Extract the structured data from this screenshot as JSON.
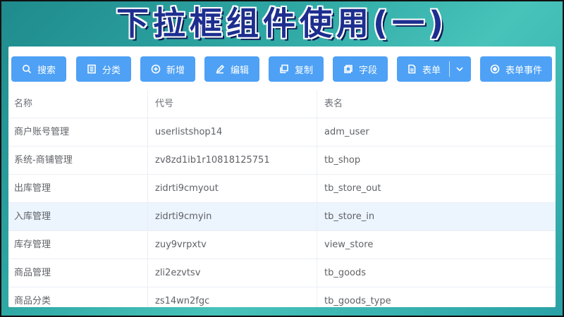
{
  "title": "下拉框组件使用(一)",
  "toolbar": {
    "search": {
      "label": "搜索",
      "icon": "search-icon"
    },
    "category": {
      "label": "分类",
      "icon": "list-icon"
    },
    "add": {
      "label": "新增",
      "icon": "plus-circle-icon"
    },
    "edit": {
      "label": "编辑",
      "icon": "pencil-icon"
    },
    "copy": {
      "label": "复制",
      "icon": "copy-icon"
    },
    "fields": {
      "label": "字段",
      "icon": "fields-icon"
    },
    "form": {
      "label": "表单",
      "icon": "document-icon"
    },
    "form_events": {
      "label": "表单事件",
      "icon": "target-icon"
    }
  },
  "colors": {
    "button": "#4ea1f5",
    "highlight_row": "#ecf4fd",
    "title": "#1d2e8f"
  },
  "table": {
    "columns": [
      "名称",
      "代号",
      "表名"
    ],
    "rows": [
      [
        "商户账号管理",
        "userlistshop14",
        "adm_user"
      ],
      [
        "系统-商铺管理",
        "zv8zd1ib1r10818125751",
        "tb_shop"
      ],
      [
        "出库管理",
        "zidrti9cmyout",
        "tb_store_out"
      ],
      [
        "入库管理",
        "zidrti9cmyin",
        "tb_store_in"
      ],
      [
        "库存管理",
        "zuy9vrpxtv",
        "view_store"
      ],
      [
        "商品管理",
        "zli2ezvtsv",
        "tb_goods"
      ],
      [
        "商品分类",
        "zs14wn2fgc",
        "tb_goods_type"
      ]
    ],
    "highlighted_row": 3
  }
}
